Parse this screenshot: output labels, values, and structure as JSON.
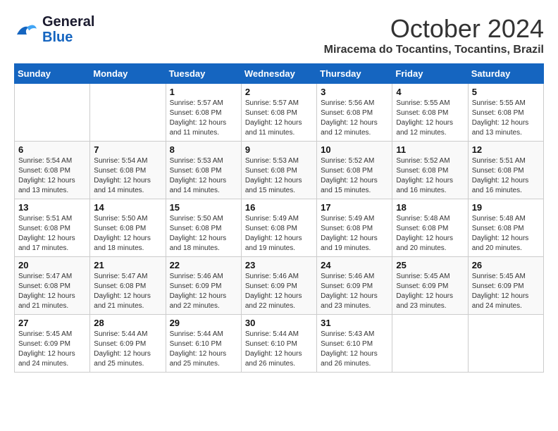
{
  "header": {
    "logo_line1": "General",
    "logo_line2": "Blue",
    "month": "October 2024",
    "location": "Miracema do Tocantins, Tocantins, Brazil"
  },
  "days_of_week": [
    "Sunday",
    "Monday",
    "Tuesday",
    "Wednesday",
    "Thursday",
    "Friday",
    "Saturday"
  ],
  "weeks": [
    [
      {
        "day": "",
        "info": ""
      },
      {
        "day": "",
        "info": ""
      },
      {
        "day": "1",
        "info": "Sunrise: 5:57 AM\nSunset: 6:08 PM\nDaylight: 12 hours and 11 minutes."
      },
      {
        "day": "2",
        "info": "Sunrise: 5:57 AM\nSunset: 6:08 PM\nDaylight: 12 hours and 11 minutes."
      },
      {
        "day": "3",
        "info": "Sunrise: 5:56 AM\nSunset: 6:08 PM\nDaylight: 12 hours and 12 minutes."
      },
      {
        "day": "4",
        "info": "Sunrise: 5:55 AM\nSunset: 6:08 PM\nDaylight: 12 hours and 12 minutes."
      },
      {
        "day": "5",
        "info": "Sunrise: 5:55 AM\nSunset: 6:08 PM\nDaylight: 12 hours and 13 minutes."
      }
    ],
    [
      {
        "day": "6",
        "info": "Sunrise: 5:54 AM\nSunset: 6:08 PM\nDaylight: 12 hours and 13 minutes."
      },
      {
        "day": "7",
        "info": "Sunrise: 5:54 AM\nSunset: 6:08 PM\nDaylight: 12 hours and 14 minutes."
      },
      {
        "day": "8",
        "info": "Sunrise: 5:53 AM\nSunset: 6:08 PM\nDaylight: 12 hours and 14 minutes."
      },
      {
        "day": "9",
        "info": "Sunrise: 5:53 AM\nSunset: 6:08 PM\nDaylight: 12 hours and 15 minutes."
      },
      {
        "day": "10",
        "info": "Sunrise: 5:52 AM\nSunset: 6:08 PM\nDaylight: 12 hours and 15 minutes."
      },
      {
        "day": "11",
        "info": "Sunrise: 5:52 AM\nSunset: 6:08 PM\nDaylight: 12 hours and 16 minutes."
      },
      {
        "day": "12",
        "info": "Sunrise: 5:51 AM\nSunset: 6:08 PM\nDaylight: 12 hours and 16 minutes."
      }
    ],
    [
      {
        "day": "13",
        "info": "Sunrise: 5:51 AM\nSunset: 6:08 PM\nDaylight: 12 hours and 17 minutes."
      },
      {
        "day": "14",
        "info": "Sunrise: 5:50 AM\nSunset: 6:08 PM\nDaylight: 12 hours and 18 minutes."
      },
      {
        "day": "15",
        "info": "Sunrise: 5:50 AM\nSunset: 6:08 PM\nDaylight: 12 hours and 18 minutes."
      },
      {
        "day": "16",
        "info": "Sunrise: 5:49 AM\nSunset: 6:08 PM\nDaylight: 12 hours and 19 minutes."
      },
      {
        "day": "17",
        "info": "Sunrise: 5:49 AM\nSunset: 6:08 PM\nDaylight: 12 hours and 19 minutes."
      },
      {
        "day": "18",
        "info": "Sunrise: 5:48 AM\nSunset: 6:08 PM\nDaylight: 12 hours and 20 minutes."
      },
      {
        "day": "19",
        "info": "Sunrise: 5:48 AM\nSunset: 6:08 PM\nDaylight: 12 hours and 20 minutes."
      }
    ],
    [
      {
        "day": "20",
        "info": "Sunrise: 5:47 AM\nSunset: 6:08 PM\nDaylight: 12 hours and 21 minutes."
      },
      {
        "day": "21",
        "info": "Sunrise: 5:47 AM\nSunset: 6:08 PM\nDaylight: 12 hours and 21 minutes."
      },
      {
        "day": "22",
        "info": "Sunrise: 5:46 AM\nSunset: 6:09 PM\nDaylight: 12 hours and 22 minutes."
      },
      {
        "day": "23",
        "info": "Sunrise: 5:46 AM\nSunset: 6:09 PM\nDaylight: 12 hours and 22 minutes."
      },
      {
        "day": "24",
        "info": "Sunrise: 5:46 AM\nSunset: 6:09 PM\nDaylight: 12 hours and 23 minutes."
      },
      {
        "day": "25",
        "info": "Sunrise: 5:45 AM\nSunset: 6:09 PM\nDaylight: 12 hours and 23 minutes."
      },
      {
        "day": "26",
        "info": "Sunrise: 5:45 AM\nSunset: 6:09 PM\nDaylight: 12 hours and 24 minutes."
      }
    ],
    [
      {
        "day": "27",
        "info": "Sunrise: 5:45 AM\nSunset: 6:09 PM\nDaylight: 12 hours and 24 minutes."
      },
      {
        "day": "28",
        "info": "Sunrise: 5:44 AM\nSunset: 6:09 PM\nDaylight: 12 hours and 25 minutes."
      },
      {
        "day": "29",
        "info": "Sunrise: 5:44 AM\nSunset: 6:10 PM\nDaylight: 12 hours and 25 minutes."
      },
      {
        "day": "30",
        "info": "Sunrise: 5:44 AM\nSunset: 6:10 PM\nDaylight: 12 hours and 26 minutes."
      },
      {
        "day": "31",
        "info": "Sunrise: 5:43 AM\nSunset: 6:10 PM\nDaylight: 12 hours and 26 minutes."
      },
      {
        "day": "",
        "info": ""
      },
      {
        "day": "",
        "info": ""
      }
    ]
  ]
}
